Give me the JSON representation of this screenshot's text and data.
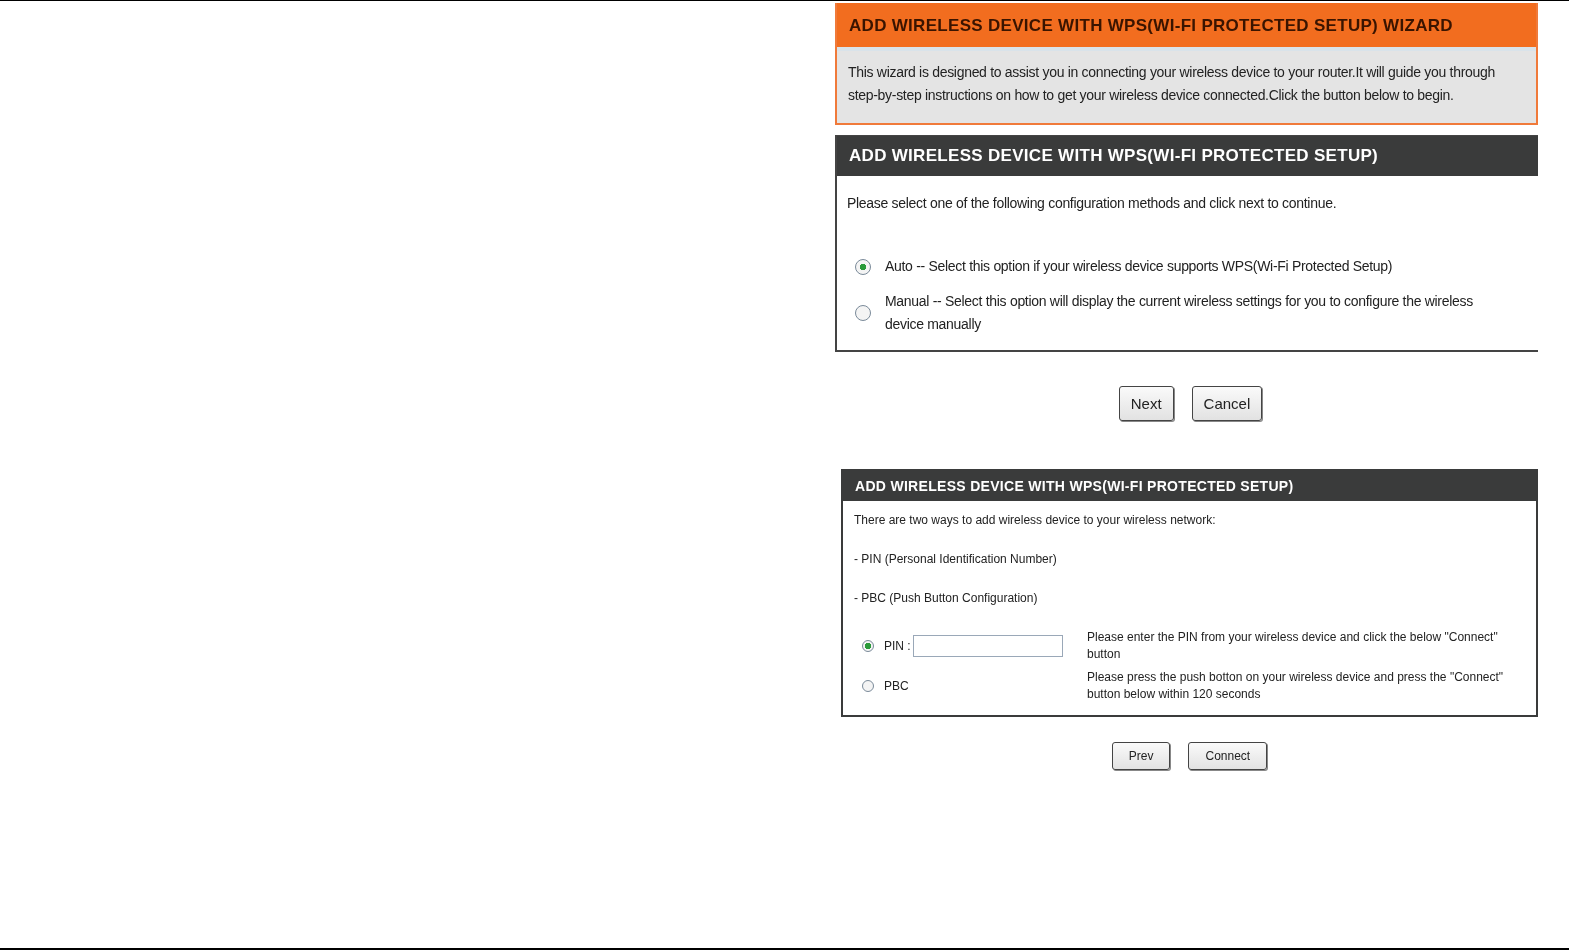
{
  "wizard": {
    "title": "ADD WIRELESS DEVICE WITH WPS(WI-FI PROTECTED SETUP) WIZARD",
    "description": "This wizard is designed to assist you in connecting your wireless device to your router.It will guide you through step-by-step instructions on how to get your wireless device connected.Click the button below to begin."
  },
  "method_panel": {
    "title": "ADD WIRELESS DEVICE WITH WPS(WI-FI PROTECTED SETUP)",
    "prompt": "Please select one of the following configuration methods and click next to continue.",
    "options": [
      {
        "label": "Auto -- Select this option if your wireless device supports WPS(Wi-Fi Protected Setup)",
        "selected": true
      },
      {
        "label": "Manual -- Select this option will display the current wireless settings for you to configure the wireless device manually",
        "selected": false
      }
    ]
  },
  "method_buttons": [
    "Next",
    "Cancel"
  ],
  "wps_panel": {
    "title": "ADD WIRELESS DEVICE WITH WPS(WI-FI PROTECTED SETUP)",
    "intro": "There are two ways to add wireless device to your wireless network:",
    "methods": [
      "- PIN (Personal Identification Number)",
      "- PBC (Push Button Configuration)"
    ],
    "options": [
      {
        "kind": "pin",
        "label": "PIN :",
        "selected": true,
        "hint": "Please enter the PIN from your wireless device and click the below \"Connect\" button"
      },
      {
        "kind": "pbc",
        "label": "PBC",
        "selected": false,
        "hint": "Please press the push botton on your wireless device and press the \"Connect\" button below within 120 seconds"
      }
    ]
  },
  "wps_buttons": [
    "Prev",
    "Connect"
  ]
}
